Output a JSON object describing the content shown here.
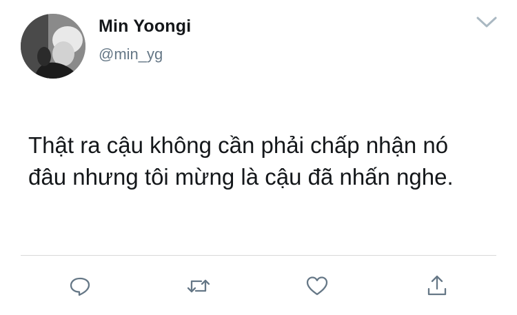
{
  "user": {
    "display_name": "Min Yoongi",
    "handle": "@min_yg",
    "avatar_icon": "profile-photo-monochrome"
  },
  "tweet": {
    "text": "Thật ra cậu không cần phải chấp nhận nó\nđâu nhưng tôi mừng là cậu đã nhấn nghe."
  },
  "actions": {
    "icons": [
      "reply-icon",
      "retweet-icon",
      "like-icon",
      "share-icon"
    ]
  },
  "header": {
    "menu_icon": "chevron-down-icon"
  },
  "colors": {
    "text": "#14171a",
    "secondary_text": "#657786",
    "icon": "#657786",
    "divider": "#d8d8d8"
  }
}
